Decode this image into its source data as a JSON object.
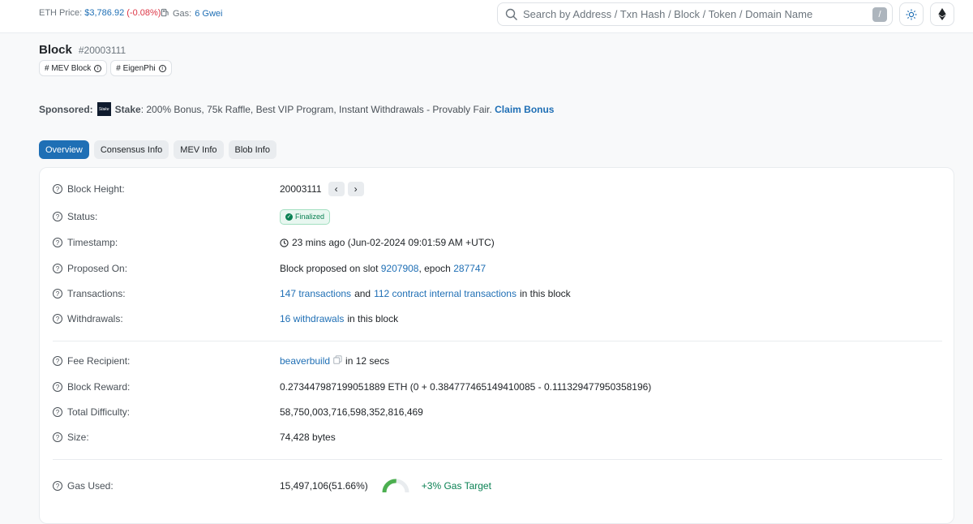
{
  "topbar": {
    "eth_price_label": "ETH Price:",
    "eth_price": "$3,786.92",
    "eth_change": "(-0.08%)",
    "gas_label": "Gas:",
    "gas_value": "6 Gwei",
    "search_placeholder": "Search by Address / Txn Hash / Block / Token / Domain Name",
    "search_shortcut": "/"
  },
  "header": {
    "title": "Block",
    "block_number": "#20003111",
    "tags": [
      "# MEV Block",
      "# EigenPhi"
    ]
  },
  "sponsored": {
    "label": "Sponsored:",
    "logo_text": "Stake",
    "name": "Stake",
    "text": ": 200% Bonus, 75k Raffle, Best VIP Program, Instant Withdrawals - Provably Fair.",
    "cta": "Claim Bonus"
  },
  "tabs": [
    "Overview",
    "Consensus Info",
    "MEV Info",
    "Blob Info"
  ],
  "rows": {
    "block_height": {
      "label": "Block Height:",
      "value": "20003111"
    },
    "status": {
      "label": "Status:",
      "value": "Finalized"
    },
    "timestamp": {
      "label": "Timestamp:",
      "value": "23 mins ago (Jun-02-2024 09:01:59 AM +UTC)"
    },
    "proposed_on": {
      "label": "Proposed On:",
      "prefix": "Block proposed on slot",
      "slot": "9207908",
      "mid": ", epoch",
      "epoch": "287747"
    },
    "transactions": {
      "label": "Transactions:",
      "txns": "147 transactions",
      "and": "and",
      "internal": "112 contract internal transactions",
      "suffix": "in this block"
    },
    "withdrawals": {
      "label": "Withdrawals:",
      "link": "16 withdrawals",
      "suffix": "in this block"
    },
    "fee_recipient": {
      "label": "Fee Recipient:",
      "link": "beaverbuild",
      "suffix": "in 12 secs"
    },
    "block_reward": {
      "label": "Block Reward:",
      "value": "0.273447987199051889 ETH (0 + 0.384777465149410085 - 0.111329477950358196)"
    },
    "total_difficulty": {
      "label": "Total Difficulty:",
      "value": "58,750,003,716,598,352,816,469"
    },
    "size": {
      "label": "Size:",
      "value": "74,428 bytes"
    },
    "gas_used": {
      "label": "Gas Used:",
      "value": "15,497,106",
      "percent_text": "(51.66%)",
      "percent": 51.66,
      "target": "+3% Gas Target"
    }
  },
  "colors": {
    "accent": "#1f6fb5",
    "success": "#0a8153",
    "gauge_fill": "#4caf50"
  },
  "icons": [
    "search-icon",
    "sun-icon",
    "ethereum-icon",
    "gas-pump-icon",
    "question-icon",
    "info-icon",
    "clock-icon",
    "copy-icon",
    "check-circle-icon",
    "chevron-left-icon",
    "chevron-right-icon"
  ]
}
